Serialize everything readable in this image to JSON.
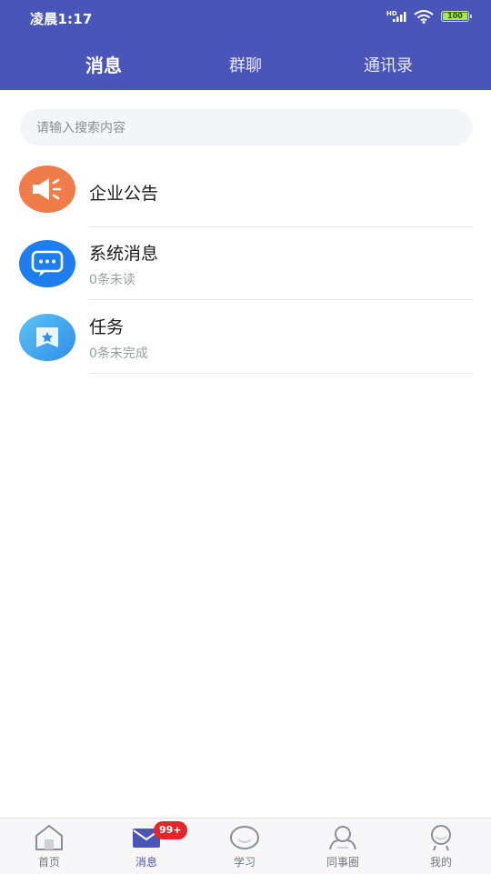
{
  "status_bar": {
    "time": "凌晨1:17",
    "network_label": "HD",
    "battery_level": "100",
    "icons": [
      "signal-icon",
      "wifi-icon",
      "battery-icon"
    ]
  },
  "header": {
    "tabs": [
      {
        "label": "消息",
        "active": true
      },
      {
        "label": "群聊",
        "active": false
      },
      {
        "label": "通讯录",
        "active": false
      }
    ],
    "background_color": "#4a55b9"
  },
  "search": {
    "placeholder": "请输入搜索内容",
    "value": ""
  },
  "conversations": [
    {
      "title": "企业公告",
      "subtitle": "",
      "icon": "megaphone-icon",
      "color": "#f07c4a"
    },
    {
      "title": "系统消息",
      "subtitle": "0条未读",
      "icon": "chat-bubble-icon",
      "color": "#1e7ef0"
    },
    {
      "title": "任务",
      "subtitle": "0条未完成",
      "icon": "task-icon",
      "color": "#3aa0f0"
    }
  ],
  "bottom_nav": {
    "items": [
      {
        "label": "首页",
        "icon": "home-icon",
        "active": false
      },
      {
        "label": "消息",
        "icon": "mail-icon",
        "active": true
      },
      {
        "label": "学习",
        "icon": "study-icon",
        "active": false
      },
      {
        "label": "同事圈",
        "icon": "colleagues-icon",
        "active": false
      },
      {
        "label": "我的",
        "icon": "profile-icon",
        "active": false
      }
    ],
    "badge": "99+"
  }
}
